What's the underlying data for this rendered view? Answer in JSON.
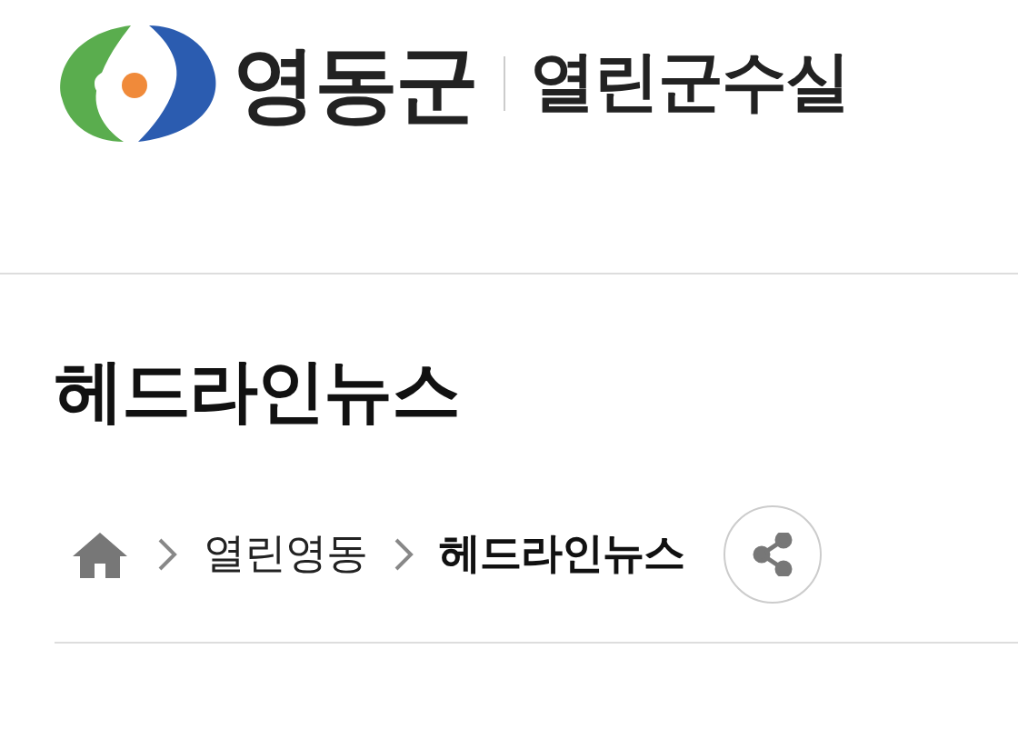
{
  "header": {
    "org": "영동군",
    "section": "열린군수실"
  },
  "page_title": "헤드라인뉴스",
  "breadcrumb": [
    {
      "label": "열린영동",
      "selected": false
    },
    {
      "label": "헤드라인뉴스",
      "selected": true
    }
  ]
}
